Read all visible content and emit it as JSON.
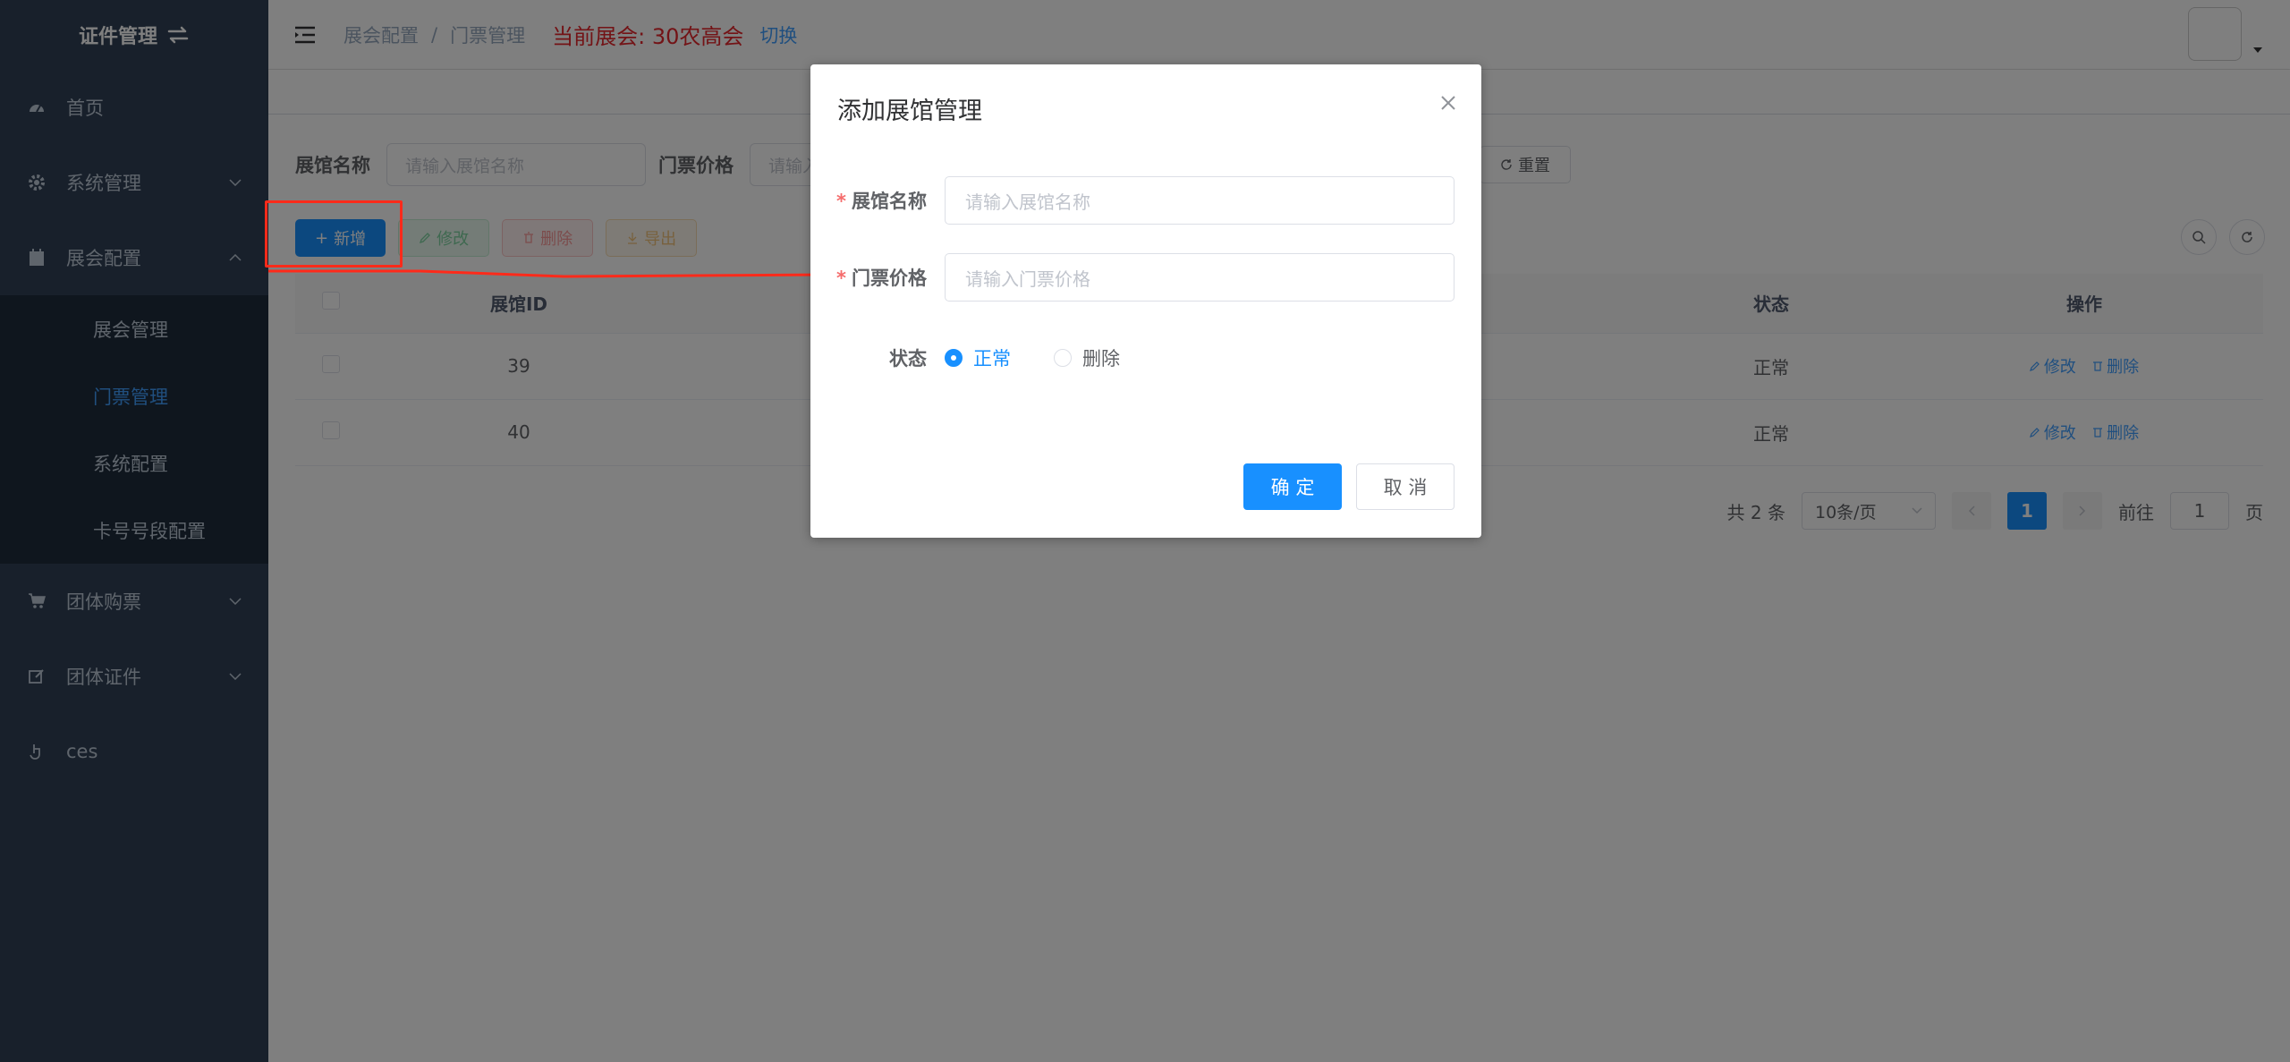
{
  "sidebar": {
    "brand": "证件管理",
    "items": [
      {
        "label": "首页",
        "icon": "dashboard-icon"
      },
      {
        "label": "系统管理",
        "icon": "gear-icon"
      },
      {
        "label": "展会配置",
        "icon": "calendar-icon"
      }
    ],
    "submenu": [
      {
        "label": "展会管理"
      },
      {
        "label": "门票管理"
      },
      {
        "label": "系统配置"
      },
      {
        "label": "卡号号段配置"
      }
    ],
    "items_after": [
      {
        "label": "团体购票",
        "icon": "cart-icon"
      },
      {
        "label": "团体证件",
        "icon": "edit-icon"
      },
      {
        "label": "ces",
        "icon": "hand-icon"
      }
    ]
  },
  "header": {
    "breadcrumb": [
      "展会配置",
      "门票管理"
    ],
    "separator": "/",
    "current_fair_label": "当前展会:",
    "current_fair_value": "30农高会",
    "switch_label": "切换"
  },
  "search": {
    "hall_name_label": "展馆名称",
    "hall_name_placeholder": "请输入展馆名称",
    "price_label": "门票价格",
    "price_placeholder": "请输入",
    "reset_label": "重置"
  },
  "toolbar": {
    "add_label": "新增",
    "edit_label": "修改",
    "delete_label": "删除",
    "export_label": "导出"
  },
  "table": {
    "columns": [
      "展馆ID",
      "状态",
      "操作"
    ],
    "rows": [
      {
        "id": "39",
        "status": "正常",
        "edit": "修改",
        "delete": "删除"
      },
      {
        "id": "40",
        "status": "正常",
        "edit": "修改",
        "delete": "删除"
      }
    ]
  },
  "pagination": {
    "total": "共 2 条",
    "page_size": "10条/页",
    "current_page": "1",
    "goto_label": "前往",
    "goto_value": "1",
    "page_suffix": "页"
  },
  "dialog": {
    "title": "添加展馆管理",
    "hall_name_label": "展馆名称",
    "hall_name_placeholder": "请输入展馆名称",
    "price_label": "门票价格",
    "price_placeholder": "请输入门票价格",
    "required_mark": "*",
    "status_label": "状态",
    "status_options": [
      "正常",
      "删除"
    ],
    "status_selected": "正常",
    "ok_label": "确 定",
    "cancel_label": "取 消"
  },
  "colors": {
    "sidebar_bg": "#304156",
    "submenu_bg": "#1f2d3d",
    "primary": "#1890ff",
    "fair_red": "#e6262d",
    "annotation_red": "#ff2a1a"
  }
}
